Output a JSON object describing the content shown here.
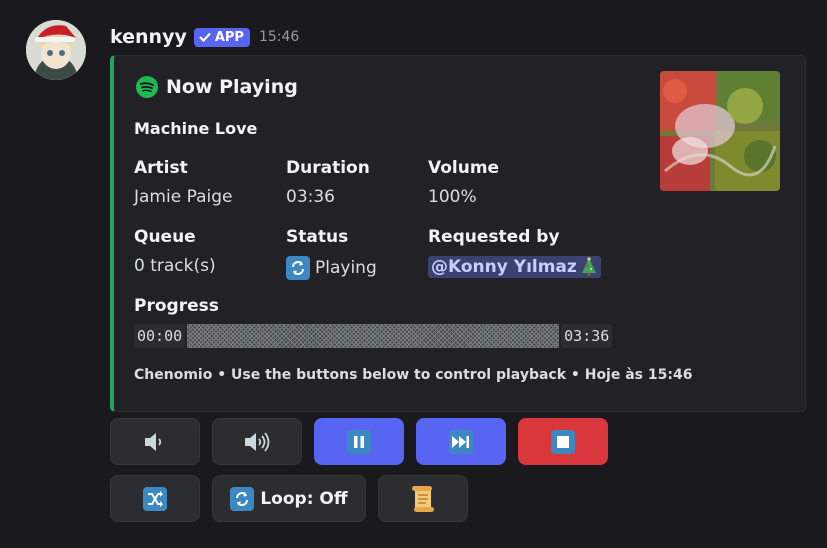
{
  "message": {
    "username": "kennyy",
    "badge": "APP",
    "timestamp": "15:46"
  },
  "embed": {
    "title": "Now Playing",
    "track": "Machine Love",
    "fields": {
      "artist": {
        "name": "Artist",
        "value": "Jamie Paige"
      },
      "duration": {
        "name": "Duration",
        "value": "03:36"
      },
      "volume": {
        "name": "Volume",
        "value": "100%"
      },
      "queue": {
        "name": "Queue",
        "value": "0 track(s)"
      },
      "status": {
        "name": "Status",
        "value": "Playing"
      },
      "requested": {
        "name": "Requested by",
        "value": "@Konny Yılmaz"
      }
    },
    "progress": {
      "label": "Progress",
      "start": "00:00",
      "end": "03:36",
      "fraction": 0
    },
    "footer": "Chenomio • Use the buttons below to control playback • Hoje às 15:46",
    "accent_color": "#23a55a"
  },
  "buttons": {
    "row1": [
      {
        "icon": "volume-down-icon",
        "style": "secondary"
      },
      {
        "icon": "volume-up-icon",
        "style": "secondary"
      },
      {
        "icon": "pause-icon",
        "style": "primary"
      },
      {
        "icon": "skip-icon",
        "style": "primary"
      },
      {
        "icon": "stop-icon",
        "style": "danger"
      }
    ],
    "row2": [
      {
        "icon": "shuffle-icon",
        "style": "secondary"
      },
      {
        "icon": "loop-icon",
        "label": "Loop: Off",
        "style": "secondary"
      },
      {
        "icon": "scroll-icon",
        "style": "secondary"
      }
    ]
  },
  "colors": {
    "primary": "#5865f2",
    "danger": "#da373c",
    "spotify": "#1db954"
  }
}
